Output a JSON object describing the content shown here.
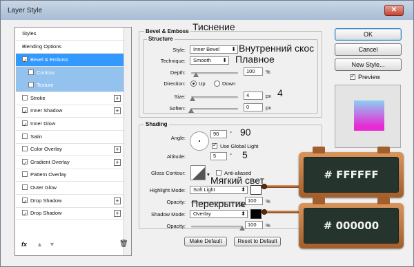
{
  "window": {
    "title": "Layer Style",
    "close_label": "✕"
  },
  "styles_panel": {
    "header": "Styles",
    "blending_options": "Blending Options",
    "items": [
      {
        "label": "Bevel & Emboss",
        "checked": true,
        "selected": true
      },
      {
        "label": "Contour",
        "checked": false,
        "sub": true
      },
      {
        "label": "Texture",
        "checked": false,
        "sub": true
      },
      {
        "label": "Stroke",
        "checked": false,
        "plus": true
      },
      {
        "label": "Inner Shadow",
        "checked": true,
        "plus": true
      },
      {
        "label": "Inner Glow",
        "checked": true
      },
      {
        "label": "Satin",
        "checked": false
      },
      {
        "label": "Color Overlay",
        "checked": false,
        "plus": true
      },
      {
        "label": "Gradient Overlay",
        "checked": true,
        "plus": true
      },
      {
        "label": "Pattern Overlay",
        "checked": false
      },
      {
        "label": "Outer Glow",
        "checked": false
      },
      {
        "label": "Drop Shadow",
        "checked": true,
        "plus": true
      },
      {
        "label": "Drop Shadow",
        "checked": true,
        "plus": true
      }
    ],
    "fx_label": "fx"
  },
  "bevel": {
    "title": "Bevel & Emboss",
    "structure_title": "Structure",
    "style_label": "Style:",
    "style_value": "Inner Bevel",
    "technique_label": "Technique:",
    "technique_value": "Smooth",
    "depth_label": "Depth:",
    "depth_value": "100",
    "depth_unit": "%",
    "depth_level": 0.1,
    "direction_label": "Direction:",
    "dir_up": "Up",
    "dir_down": "Down",
    "size_label": "Size:",
    "size_value": "4",
    "size_unit": "px",
    "size_level": 0.03,
    "soften_label": "Soften:",
    "soften_value": "0",
    "soften_unit": "px",
    "soften_level": 0.0
  },
  "shading": {
    "title": "Shading",
    "angle_label": "Angle:",
    "angle_value": "90",
    "angle_unit": "°",
    "global_light_label": "Use Global Light",
    "altitude_label": "Altitude:",
    "altitude_value": "5",
    "altitude_unit": "°",
    "gloss_label": "Gloss Contour:",
    "anti_aliased_label": "Anti-aliased",
    "highlight_label": "Highlight Mode:",
    "highlight_value": "Soft Light",
    "highlight_color": "#ffffff",
    "h_opacity_label": "Opacity:",
    "h_opacity_value": "100",
    "h_opacity_unit": "%",
    "h_opacity_level": 1.0,
    "shadow_label": "Shadow Mode:",
    "shadow_value": "Overlay",
    "shadow_color": "#000000",
    "s_opacity_label": "Opacity:",
    "s_opacity_value": "100",
    "s_opacity_unit": "%",
    "s_opacity_level": 1.0
  },
  "bottom_buttons": {
    "make_default": "Make Default",
    "reset_default": "Reset to Default"
  },
  "right_panel": {
    "ok": "OK",
    "cancel": "Cancel",
    "new_style": "New Style...",
    "preview_label": "Preview"
  },
  "annotations": {
    "emboss": "Тиснение",
    "inner_bevel": "Внутренний скос",
    "smooth": "Плавное",
    "size": "4",
    "angle": "90",
    "altitude": "5",
    "soft_light": "Мягкий свет",
    "overlay": "Перекрытие"
  },
  "boards": {
    "highlight": "# FFFFFF",
    "shadow": "# 000000"
  }
}
